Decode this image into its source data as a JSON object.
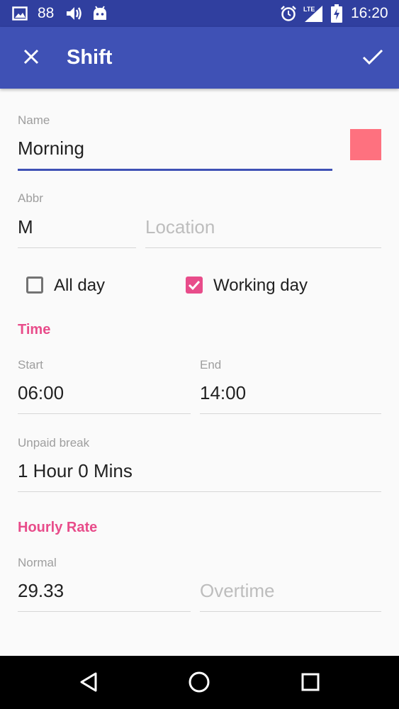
{
  "status_bar": {
    "notification_count": "88",
    "time": "16:20",
    "network": "LTE",
    "icons": [
      "image-icon",
      "volume-icon",
      "android-icon",
      "alarm-icon",
      "signal-icon",
      "battery-icon"
    ]
  },
  "app_bar": {
    "title": "Shift",
    "close_icon": "close-icon",
    "save_icon": "check-icon"
  },
  "form": {
    "name": {
      "label": "Name",
      "value": "Morning"
    },
    "color_swatch": "#fe717f",
    "abbr": {
      "label": "Abbr",
      "value": "M"
    },
    "location": {
      "placeholder": "Location"
    },
    "all_day": {
      "label": "All day",
      "checked": false
    },
    "working_day": {
      "label": "Working day",
      "checked": true
    }
  },
  "time_section": {
    "title": "Time",
    "start": {
      "label": "Start",
      "value": "06:00"
    },
    "end": {
      "label": "End",
      "value": "14:00"
    },
    "unpaid_break": {
      "label": "Unpaid break",
      "value": "1 Hour 0 Mins"
    }
  },
  "rate_section": {
    "title": "Hourly Rate",
    "normal": {
      "label": "Normal",
      "value": "29.33"
    },
    "overtime": {
      "placeholder": "Overtime"
    }
  },
  "colors": {
    "primary": "#3f51b5",
    "primary_dark": "#303f9f",
    "accent": "#e84c8a"
  },
  "nav_bar": {
    "icons": [
      "back-icon",
      "home-icon",
      "recents-icon"
    ]
  }
}
